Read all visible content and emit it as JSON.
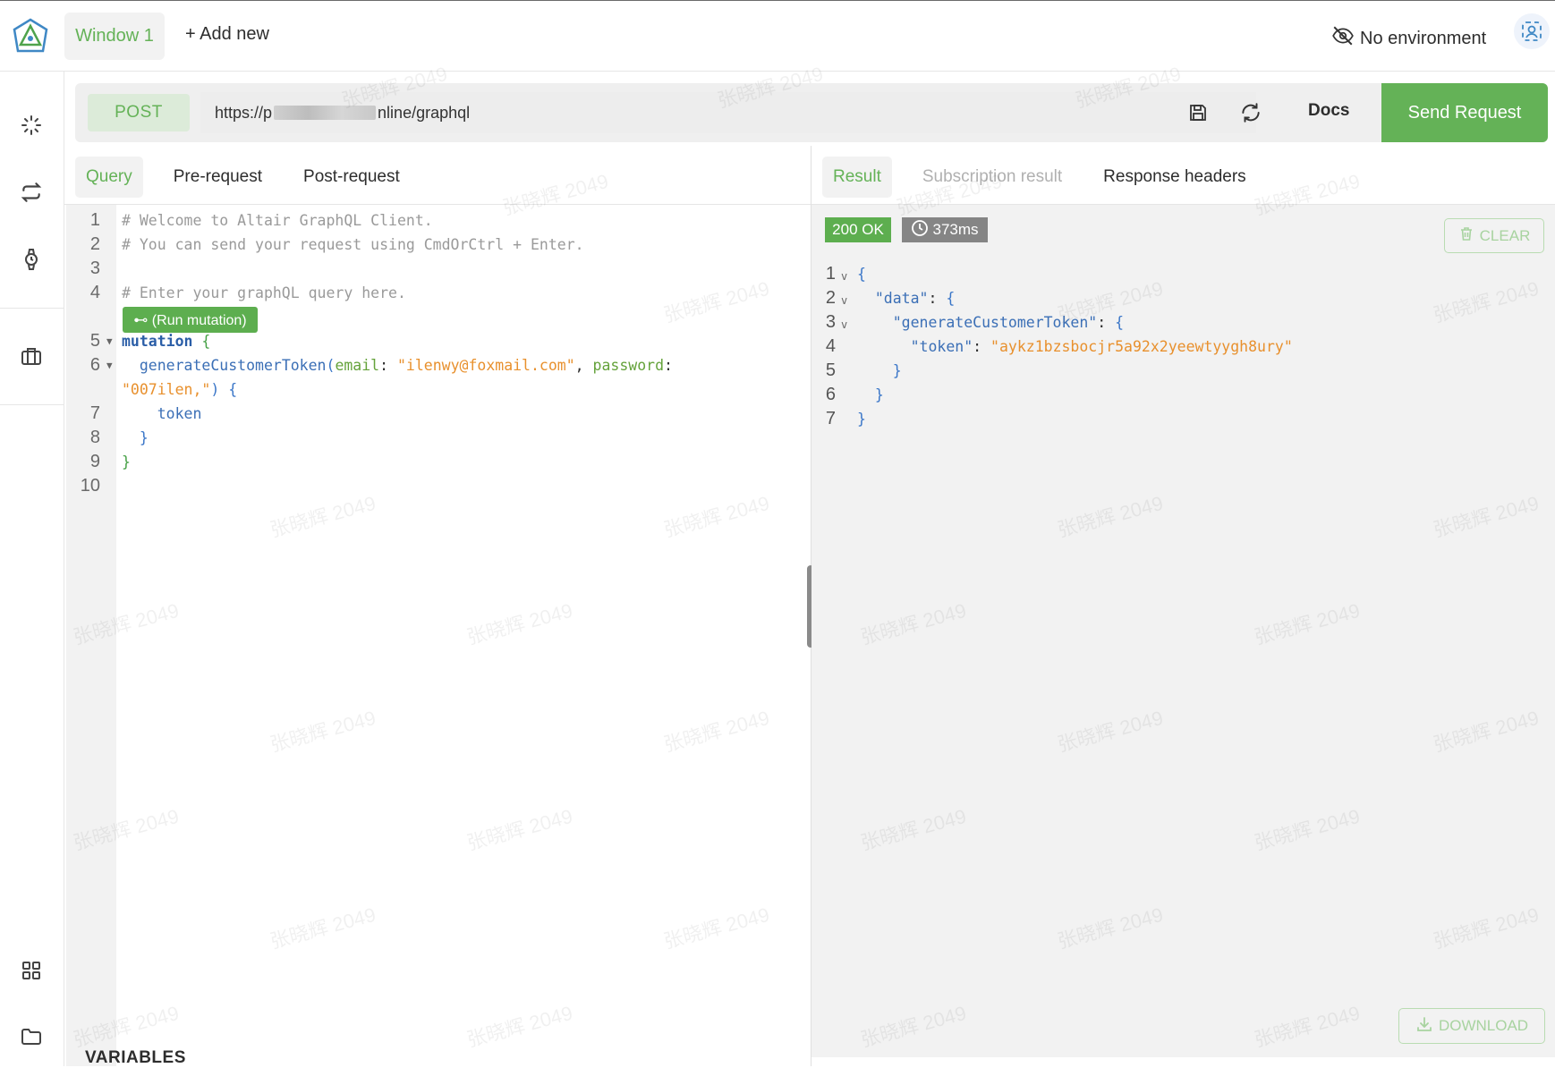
{
  "top_bar": {
    "window_tab": "Window 1",
    "add_new": "+ Add new",
    "environment": "No environment"
  },
  "url_bar": {
    "method": "POST",
    "url_prefix": "https://p",
    "url_suffix": "nline/graphql",
    "docs": "Docs",
    "send": "Send Request"
  },
  "query_tabs": [
    "Query",
    "Pre-request",
    "Post-request"
  ],
  "result_tabs": [
    "Result",
    "Subscription result",
    "Response headers"
  ],
  "editor": {
    "run_badge": "⊷ (Run mutation)",
    "line_numbers": [
      "1",
      "2",
      "3",
      "4",
      "5",
      "6",
      "",
      "7",
      "8",
      "9",
      "10"
    ],
    "comment1": "# Welcome to Altair GraphQL Client.",
    "comment2": "# You can send your request using CmdOrCtrl + Enter.",
    "comment4": "# Enter your graphQL query here.",
    "kw_mutation": "mutation",
    "fn_name": "generateCustomerToken",
    "arg_email": "email",
    "val_email": "\"ilenwy@foxmail.com\"",
    "arg_password": "password",
    "val_password": "\"007ilen,\"",
    "field_token": "token"
  },
  "variables_label": "VARIABLES",
  "result": {
    "status": "200 OK",
    "time": "373ms",
    "clear": "CLEAR",
    "download": "DOWNLOAD",
    "key_data": "\"data\"",
    "key_gen": "\"generateCustomerToken\"",
    "key_token": "\"token\"",
    "val_token": "\"aykz1bzsbocjr5a92x2yeewtyygh8ury\""
  },
  "watermark": "张晓辉 2049",
  "colors": {
    "accent": "#64b257",
    "string": "#e8902d",
    "keyword": "#2b5ea7"
  }
}
